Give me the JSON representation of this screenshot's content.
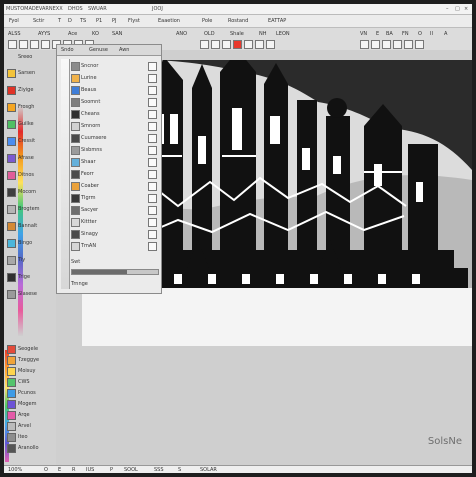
{
  "app": {
    "title": "MUSTOMADEVARNEXX",
    "title_tab": "DHOS",
    "title_secondary": "SWUAR",
    "title_right": "JOOJ",
    "window_buttons": [
      "–",
      "□",
      "×"
    ]
  },
  "menubar": {
    "items": [
      "Fyol",
      "Sctir",
      "T",
      "D",
      "TS",
      "P1",
      "PJ",
      "Flyst",
      "Eaaetion",
      "Pole",
      "Rostand",
      "EATTAP"
    ]
  },
  "toolbar": {
    "left_items": [
      "ALSS",
      "AYYS",
      "Ace",
      "KO",
      "SAN"
    ],
    "right_items": [
      "VN",
      "E",
      "BA",
      "FN",
      "O",
      "II",
      "A"
    ],
    "labels": [
      "ANO",
      "OLD",
      "Shale",
      "NH",
      "LEON"
    ]
  },
  "left_panel": {
    "header": "Sreeo",
    "rows": [
      {
        "label": "Sarsen",
        "color": "#f3c33a"
      },
      {
        "label": "Ziyige",
        "color": "#e03327"
      },
      {
        "label": "Frosgh",
        "color": "#f5a623"
      },
      {
        "label": "Guilke",
        "color": "#4fbf63"
      },
      {
        "label": "Cressit",
        "color": "#4a8ef2"
      },
      {
        "label": "Afrase",
        "color": "#7b5ad0"
      },
      {
        "label": "Ditnos",
        "color": "#e05d99"
      },
      {
        "label": "Mocom",
        "color": "#3e3e3e"
      },
      {
        "label": "Brogtem",
        "color": "#b5b5b5"
      },
      {
        "label": "Bannalt",
        "color": "#d48a34"
      },
      {
        "label": "Bingo",
        "color": "#4cb6db"
      },
      {
        "label": "Tiy",
        "color": "#a8a8a8"
      },
      {
        "label": "Trige",
        "color": "#2f2f2f"
      },
      {
        "label": "Slasese",
        "color": "#9a9a9a"
      }
    ],
    "lower_rows": [
      {
        "label": "Seogele",
        "color": "#e34b3a"
      },
      {
        "label": "Tzeggye",
        "color": "#f0a43a"
      },
      {
        "label": "Moisuy",
        "color": "#ffd44d"
      },
      {
        "label": "CWS",
        "color": "#53c46c"
      },
      {
        "label": "Pcunos",
        "color": "#3e9be6"
      },
      {
        "label": "Mogem",
        "color": "#6c53d6"
      },
      {
        "label": "Arqe",
        "color": "#e35aa8"
      },
      {
        "label": "Arvel",
        "color": "#bbbbbb"
      },
      {
        "label": "Iteo",
        "color": "#8e8e8e"
      },
      {
        "label": "Aranollo",
        "color": "#555555"
      }
    ]
  },
  "floating_panel": {
    "title": "Sndo",
    "tabs": [
      "Genuse",
      "Awn"
    ],
    "rows": [
      {
        "label": "Sncnor",
        "color": "#8b8b8b"
      },
      {
        "label": "Lurine",
        "color": "#f0b24a"
      },
      {
        "label": "Beaus",
        "color": "#3f7ed8"
      },
      {
        "label": "Soomnt",
        "color": "#7e7e7e"
      },
      {
        "label": "Cheans",
        "color": "#2e2e2e"
      },
      {
        "label": "Smnorn",
        "color": "#d1d1d1"
      },
      {
        "label": "Cuumsere",
        "color": "#4b4b4b"
      },
      {
        "label": "Sisbmns",
        "color": "#9b9b9b"
      },
      {
        "label": "Shaar",
        "color": "#64b0db"
      },
      {
        "label": "Feorr",
        "color": "#4c4c4c"
      },
      {
        "label": "Coaber",
        "color": "#eba23b"
      },
      {
        "label": "Tlgrm",
        "color": "#3a3a3a"
      },
      {
        "label": "Sacyer",
        "color": "#6e6e6e"
      },
      {
        "label": "Kittter",
        "color": "#d8d8d8"
      },
      {
        "label": "Sinagy",
        "color": "#4a4a4a"
      },
      {
        "label": "TmAN",
        "color": "#d6d6d6"
      }
    ],
    "slider_label": "Swt",
    "slider_value": 0.64,
    "footer": "Trnnge"
  },
  "canvas": {
    "accent": "#e8392d",
    "watermark": "SolsNe"
  },
  "statusbar": {
    "items": [
      "100%",
      "O",
      "E",
      "R",
      "IUS",
      "P",
      "SOOL",
      "SSS",
      "S",
      "SOLAR"
    ]
  }
}
